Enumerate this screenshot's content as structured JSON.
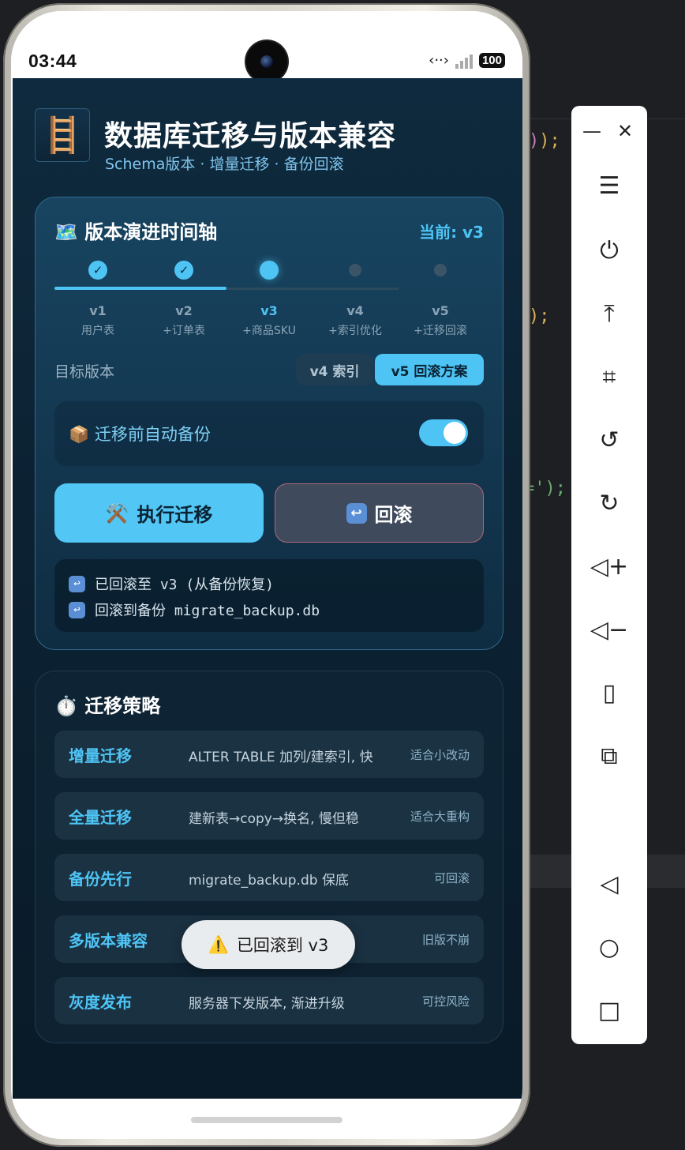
{
  "status_bar": {
    "time": "03:44",
    "battery": "100"
  },
  "header": {
    "icon": "🪜",
    "title": "数据库迁移与版本兼容",
    "subtitle": "Schema版本 · 增量迁移 · 备份回滚"
  },
  "timeline": {
    "title": "🗺️ 版本演进时间轴",
    "current": "当前: v3",
    "steps": [
      {
        "version": "v1",
        "desc": "用户表",
        "state": "done"
      },
      {
        "version": "v2",
        "desc": "+订单表",
        "state": "done"
      },
      {
        "version": "v3",
        "desc": "+商品SKU",
        "state": "current"
      },
      {
        "version": "v4",
        "desc": "+索引优化",
        "state": "future"
      },
      {
        "version": "v5",
        "desc": "+迁移回滚",
        "state": "future"
      }
    ],
    "check_glyph": "✓",
    "target_label": "目标版本",
    "target_options": [
      "v4 索引",
      "v5 回滚方案"
    ],
    "target_selected": "v5 回滚方案",
    "backup_label": "📦 迁移前自动备份",
    "backup_enabled": true,
    "run_icon": "⚒️",
    "run_label": "执行迁移",
    "rollback_icon": "↩",
    "rollback_label": "回滚",
    "log": [
      "已回滚至 v3 (从备份恢复)",
      "回滚到备份 migrate_backup.db"
    ]
  },
  "strategy": {
    "title": "⏱️ 迁移策略",
    "rows": [
      {
        "name": "增量迁移",
        "desc": "ALTER TABLE 加列/建索引, 快",
        "tag": "适合小改动"
      },
      {
        "name": "全量迁移",
        "desc": "建新表→copy→换名, 慢但稳",
        "tag": "适合大重构"
      },
      {
        "name": "备份先行",
        "desc": "migrate_backup.db 保底",
        "tag": "可回滚"
      },
      {
        "name": "多版本兼容",
        "desc": "",
        "tag": "旧版不崩"
      },
      {
        "name": "灰度发布",
        "desc": "服务器下发版本, 渐进升级",
        "tag": "可控风险"
      }
    ]
  },
  "toast": {
    "icon": "⚠️",
    "text": "已回滚到 v3"
  },
  "background_code": [
    ");",
    ");",
    "=');"
  ],
  "emulator_toolbar": {
    "items": [
      "minimize-icon",
      "close-icon",
      "menu-icon",
      "power-icon",
      "upload-icon",
      "crop-icon",
      "rotate-left-icon",
      "rotate-right-icon",
      "volume-up-icon",
      "volume-down-icon",
      "shake-icon",
      "device-switch-icon",
      "back-icon",
      "home-icon",
      "overview-icon"
    ]
  },
  "colors": {
    "accent": "#4ec4f5",
    "app_bg": "#0c2233",
    "rollback_border": "#b06a7a"
  }
}
